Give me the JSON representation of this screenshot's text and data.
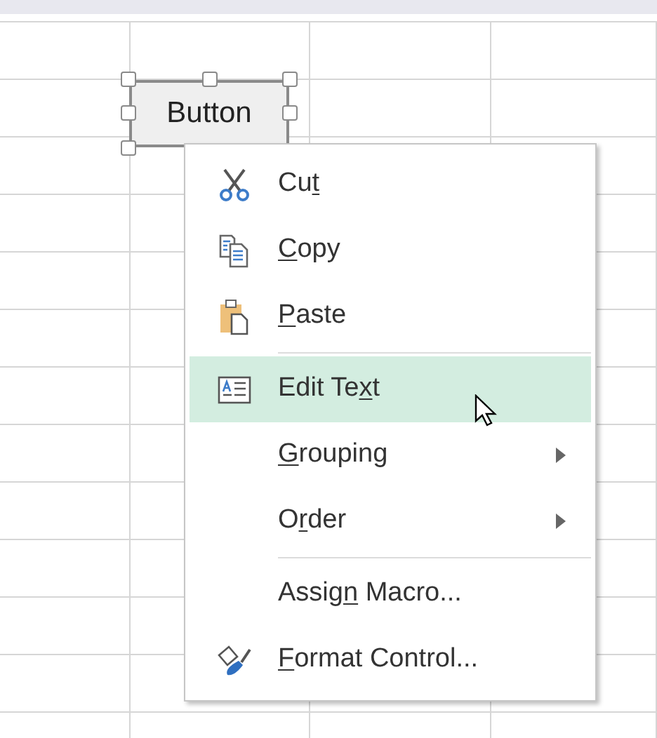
{
  "sheet_button": {
    "label": "Button",
    "selected": true
  },
  "context_menu": [
    {
      "kind": "item",
      "label": "Cu",
      "access_key": "t",
      "selected": false,
      "submenu": false
    },
    {
      "kind": "item",
      "access_key": "C",
      "label_rest": "opy",
      "selected": false,
      "submenu": false
    },
    {
      "kind": "item",
      "access_key": "P",
      "label_rest": "aste",
      "selected": false,
      "submenu": false
    },
    {
      "kind": "separator"
    },
    {
      "kind": "item",
      "label": "Edit Te",
      "access_key": "x",
      "label_rest": "t",
      "selected": true,
      "submenu": false
    },
    {
      "kind": "item",
      "access_key": "G",
      "label_rest": "rouping",
      "selected": false,
      "submenu": true
    },
    {
      "kind": "item",
      "label": "O",
      "access_key": "r",
      "label_rest": "der",
      "selected": false,
      "submenu": true
    },
    {
      "kind": "separator"
    },
    {
      "kind": "item",
      "label": "Assig",
      "access_key": "n",
      "label_rest": " Macro...",
      "selected": false,
      "submenu": false
    },
    {
      "kind": "item",
      "access_key": "F",
      "label_rest": "ormat Control...",
      "selected": false,
      "submenu": false
    }
  ]
}
